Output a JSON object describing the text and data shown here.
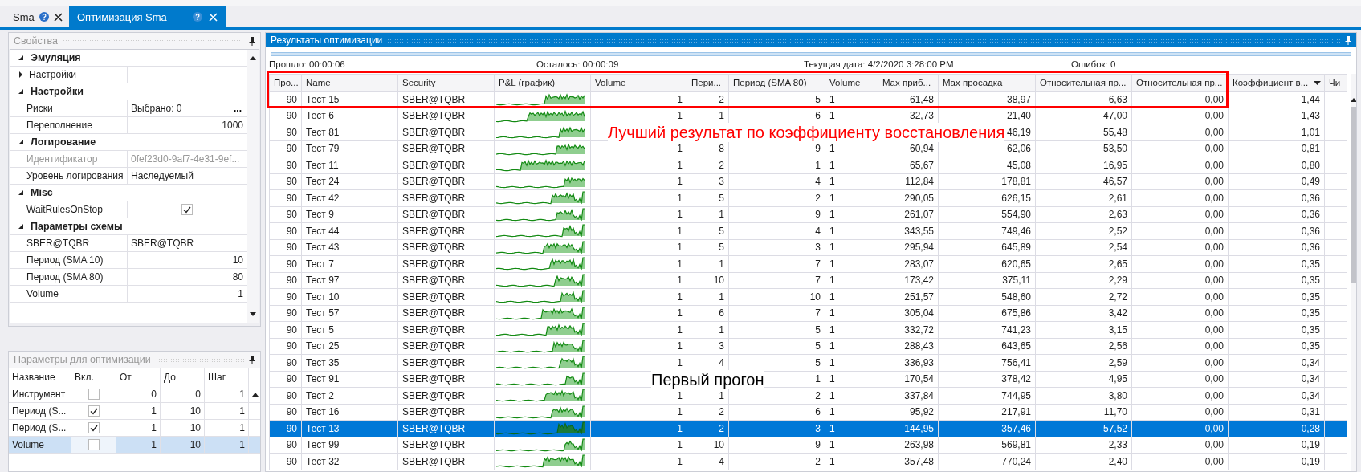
{
  "tabs": [
    {
      "label": "Sma",
      "selected": false
    },
    {
      "label": "Оптимизация Sma",
      "selected": true
    }
  ],
  "properties": {
    "title": "Свойства",
    "groups": [
      {
        "title": "Эмуляция",
        "expanded": true,
        "items": [
          {
            "kind": "subgroup",
            "label": "Настройки",
            "expanded": false,
            "disabled": false
          }
        ]
      },
      {
        "title": "Настройки",
        "expanded": true,
        "items": [
          {
            "kind": "picker",
            "label": "Риски",
            "value": "Выбрано: 0",
            "button": "...",
            "disabled": false
          },
          {
            "kind": "number",
            "label": "Переполнение",
            "value": "1000",
            "disabled": false
          }
        ]
      },
      {
        "title": "Логирование",
        "expanded": true,
        "items": [
          {
            "kind": "text",
            "label": "Идентификатор",
            "value": "0fef23d0-9af7-4e31-9ef...",
            "disabled": true
          },
          {
            "kind": "text",
            "label": "Уровень логирования",
            "value": "Наследуемый",
            "disabled": false
          }
        ]
      },
      {
        "title": "Misc",
        "expanded": true,
        "items": [
          {
            "kind": "check",
            "label": "WaitRulesOnStop",
            "checked": true,
            "disabled": false
          }
        ]
      },
      {
        "title": "Параметры схемы",
        "expanded": true,
        "items": [
          {
            "kind": "text",
            "label": "SBER@TQBR",
            "value": "SBER@TQBR",
            "disabled": false
          },
          {
            "kind": "number",
            "label": "Период (SMA 10)",
            "value": "10",
            "disabled": false
          },
          {
            "kind": "number",
            "label": "Период (SMA 80)",
            "value": "80",
            "disabled": false
          },
          {
            "kind": "number",
            "label": "Volume",
            "value": "1",
            "disabled": false
          }
        ]
      }
    ]
  },
  "optimization_params": {
    "title": "Параметры для оптимизации",
    "columns": [
      "Название",
      "Вкл.",
      "От",
      "До",
      "Шаг"
    ],
    "rows": [
      {
        "name": "Инструмент",
        "enabled": false,
        "from": "0",
        "to": "0",
        "step": "1",
        "selected": false
      },
      {
        "name": "Период (S...",
        "enabled": true,
        "from": "1",
        "to": "10",
        "step": "1",
        "selected": false
      },
      {
        "name": "Период (S...",
        "enabled": true,
        "from": "1",
        "to": "10",
        "step": "1",
        "selected": false
      },
      {
        "name": "Volume",
        "enabled": false,
        "from": "1",
        "to": "10",
        "step": "1",
        "selected": true
      }
    ]
  },
  "results": {
    "title": "Результаты оптимизации",
    "elapsed": "Прошло: 00:00:06",
    "remaining": "Осталось: 00:00:09",
    "current_date": "Текущая дата: 4/2/2020 3:28:00 PM",
    "errors": "Ошибок: 0",
    "progress": {
      "level": 1
    },
    "columns": [
      {
        "label": "Про...",
        "sorted": false
      },
      {
        "label": "Name",
        "sorted": false
      },
      {
        "label": "Security",
        "sorted": false
      },
      {
        "label": "P&L (график)",
        "sorted": false
      },
      {
        "label": "Volume",
        "sorted": false
      },
      {
        "label": "Пери...",
        "sorted": false
      },
      {
        "label": "Период (SMA 80)",
        "sorted": false
      },
      {
        "label": "Volume",
        "sorted": false
      },
      {
        "label": "Max приб...",
        "sorted": false
      },
      {
        "label": "Max просадка",
        "sorted": false
      },
      {
        "label": "Относительная пр...",
        "sorted": false
      },
      {
        "label": "Относительная пр...",
        "sorted": false
      },
      {
        "label": "Коэффициент в...",
        "sorted": true
      },
      {
        "label": "Чи",
        "sorted": false
      }
    ],
    "rows": [
      {
        "progress": "90",
        "name": "Тест 15",
        "security": "SBER@TQBR",
        "volume": "1",
        "period_sma10": "2",
        "period_sma80": "5",
        "volume_2": "1",
        "max_profit": "61,48",
        "max_drawdown": "38,97",
        "relative_a": "6,63",
        "relative_b": "0,00",
        "recovery_factor": "1,44",
        "selected": false
      },
      {
        "progress": "90",
        "name": "Тест 6",
        "security": "SBER@TQBR",
        "volume": "1",
        "period_sma10": "1",
        "period_sma80": "6",
        "volume_2": "1",
        "max_profit": "32,73",
        "max_drawdown": "21,40",
        "relative_a": "47,00",
        "relative_b": "0,00",
        "recovery_factor": "1,43",
        "selected": false
      },
      {
        "progress": "90",
        "name": "Тест 81",
        "security": "SBER@TQBR",
        "max_drawdown": "46,19",
        "relative_a": "55,48",
        "relative_b": "0,00",
        "recovery_factor": "1,01",
        "selected": false
      },
      {
        "progress": "90",
        "name": "Тест 79",
        "security": "SBER@TQBR",
        "volume": "1",
        "period_sma10": "8",
        "period_sma80": "9",
        "volume_2": "1",
        "max_profit": "60,94",
        "max_drawdown": "62,06",
        "relative_a": "53,50",
        "relative_b": "0,00",
        "recovery_factor": "0,81",
        "selected": false
      },
      {
        "progress": "90",
        "name": "Тест 11",
        "security": "SBER@TQBR",
        "volume": "1",
        "period_sma10": "2",
        "period_sma80": "1",
        "volume_2": "1",
        "max_profit": "65,67",
        "max_drawdown": "45,08",
        "relative_a": "16,95",
        "relative_b": "0,00",
        "recovery_factor": "0,80",
        "selected": false
      },
      {
        "progress": "90",
        "name": "Тест 24",
        "security": "SBER@TQBR",
        "volume": "1",
        "period_sma10": "3",
        "period_sma80": "4",
        "volume_2": "1",
        "max_profit": "112,84",
        "max_drawdown": "178,81",
        "relative_a": "46,57",
        "relative_b": "0,00",
        "recovery_factor": "0,49",
        "selected": false
      },
      {
        "progress": "90",
        "name": "Тест 42",
        "security": "SBER@TQBR",
        "volume": "1",
        "period_sma10": "5",
        "period_sma80": "2",
        "volume_2": "1",
        "max_profit": "290,05",
        "max_drawdown": "626,15",
        "relative_a": "2,61",
        "relative_b": "0,00",
        "recovery_factor": "0,36",
        "selected": false
      },
      {
        "progress": "90",
        "name": "Тест 9",
        "security": "SBER@TQBR",
        "volume": "1",
        "period_sma10": "1",
        "period_sma80": "9",
        "volume_2": "1",
        "max_profit": "261,07",
        "max_drawdown": "554,90",
        "relative_a": "2,63",
        "relative_b": "0,00",
        "recovery_factor": "0,36",
        "selected": false
      },
      {
        "progress": "90",
        "name": "Тест 44",
        "security": "SBER@TQBR",
        "volume": "1",
        "period_sma10": "5",
        "period_sma80": "4",
        "volume_2": "1",
        "max_profit": "343,55",
        "max_drawdown": "749,46",
        "relative_a": "2,52",
        "relative_b": "0,00",
        "recovery_factor": "0,36",
        "selected": false
      },
      {
        "progress": "90",
        "name": "Тест 43",
        "security": "SBER@TQBR",
        "volume": "1",
        "period_sma10": "5",
        "period_sma80": "3",
        "volume_2": "1",
        "max_profit": "295,94",
        "max_drawdown": "645,89",
        "relative_a": "2,54",
        "relative_b": "0,00",
        "recovery_factor": "0,36",
        "selected": false
      },
      {
        "progress": "90",
        "name": "Тест 7",
        "security": "SBER@TQBR",
        "volume": "1",
        "period_sma10": "1",
        "period_sma80": "7",
        "volume_2": "1",
        "max_profit": "283,07",
        "max_drawdown": "620,65",
        "relative_a": "2,65",
        "relative_b": "0,00",
        "recovery_factor": "0,35",
        "selected": false
      },
      {
        "progress": "90",
        "name": "Тест 97",
        "security": "SBER@TQBR",
        "volume": "1",
        "period_sma10": "10",
        "period_sma80": "7",
        "volume_2": "1",
        "max_profit": "173,42",
        "max_drawdown": "375,11",
        "relative_a": "2,29",
        "relative_b": "0,00",
        "recovery_factor": "0,35",
        "selected": false
      },
      {
        "progress": "90",
        "name": "Тест 10",
        "security": "SBER@TQBR",
        "volume": "1",
        "period_sma10": "1",
        "period_sma80": "10",
        "volume_2": "1",
        "max_profit": "251,57",
        "max_drawdown": "548,60",
        "relative_a": "2,72",
        "relative_b": "0,00",
        "recovery_factor": "0,35",
        "selected": false
      },
      {
        "progress": "90",
        "name": "Тест 57",
        "security": "SBER@TQBR",
        "volume": "1",
        "period_sma10": "6",
        "period_sma80": "7",
        "volume_2": "1",
        "max_profit": "305,04",
        "max_drawdown": "675,86",
        "relative_a": "3,42",
        "relative_b": "0,00",
        "recovery_factor": "0,35",
        "selected": false
      },
      {
        "progress": "90",
        "name": "Тест 5",
        "security": "SBER@TQBR",
        "volume": "1",
        "period_sma10": "1",
        "period_sma80": "5",
        "volume_2": "1",
        "max_profit": "332,72",
        "max_drawdown": "741,23",
        "relative_a": "3,15",
        "relative_b": "0,00",
        "recovery_factor": "0,35",
        "selected": false
      },
      {
        "progress": "90",
        "name": "Тест 25",
        "security": "SBER@TQBR",
        "volume": "1",
        "period_sma10": "3",
        "period_sma80": "5",
        "volume_2": "1",
        "max_profit": "288,43",
        "max_drawdown": "643,65",
        "relative_a": "2,56",
        "relative_b": "0,00",
        "recovery_factor": "0,35",
        "selected": false
      },
      {
        "progress": "90",
        "name": "Тест 35",
        "security": "SBER@TQBR",
        "volume": "1",
        "period_sma10": "4",
        "period_sma80": "5",
        "volume_2": "1",
        "max_profit": "336,93",
        "max_drawdown": "756,41",
        "relative_a": "2,59",
        "relative_b": "0,00",
        "recovery_factor": "0,34",
        "selected": false
      },
      {
        "progress": "90",
        "name": "Тест 91",
        "security": "SBER@TQBR",
        "period_sma80": "1",
        "volume_2": "1",
        "max_profit": "170,54",
        "max_drawdown": "378,42",
        "relative_a": "4,95",
        "relative_b": "0,00",
        "recovery_factor": "0,34",
        "selected": false
      },
      {
        "progress": "90",
        "name": "Тест 2",
        "security": "SBER@TQBR",
        "volume": "1",
        "period_sma10": "1",
        "period_sma80": "2",
        "volume_2": "1",
        "max_profit": "337,84",
        "max_drawdown": "744,95",
        "relative_a": "3,80",
        "relative_b": "0,00",
        "recovery_factor": "0,34",
        "selected": false
      },
      {
        "progress": "90",
        "name": "Тест 16",
        "security": "SBER@TQBR",
        "volume": "1",
        "period_sma10": "2",
        "period_sma80": "6",
        "volume_2": "1",
        "max_profit": "95,92",
        "max_drawdown": "217,91",
        "relative_a": "11,70",
        "relative_b": "0,00",
        "recovery_factor": "0,31",
        "selected": false
      },
      {
        "progress": "90",
        "name": "Тест 13",
        "security": "SBER@TQBR",
        "volume": "1",
        "period_sma10": "2",
        "period_sma80": "3",
        "volume_2": "1",
        "max_profit": "144,95",
        "max_drawdown": "357,46",
        "relative_a": "57,52",
        "relative_b": "0,00",
        "recovery_factor": "0,28",
        "selected": true
      },
      {
        "progress": "90",
        "name": "Тест 99",
        "security": "SBER@TQBR",
        "volume": "1",
        "period_sma10": "10",
        "period_sma80": "9",
        "volume_2": "1",
        "max_profit": "263,98",
        "max_drawdown": "569,81",
        "relative_a": "2,33",
        "relative_b": "0,00",
        "recovery_factor": "0,19",
        "selected": false
      },
      {
        "progress": "90",
        "name": "Тест 32",
        "security": "SBER@TQBR",
        "volume": "1",
        "period_sma10": "4",
        "period_sma80": "2",
        "volume_2": "1",
        "max_profit": "357,48",
        "max_drawdown": "770,24",
        "relative_a": "2,40",
        "relative_b": "0,00",
        "recovery_factor": "0,19",
        "selected": false
      }
    ]
  },
  "annotations": [
    {
      "kind": "callout",
      "text": "Лучший результат по коэффициенту восстановления"
    },
    {
      "kind": "caption",
      "text": "Первый прогон"
    }
  ]
}
